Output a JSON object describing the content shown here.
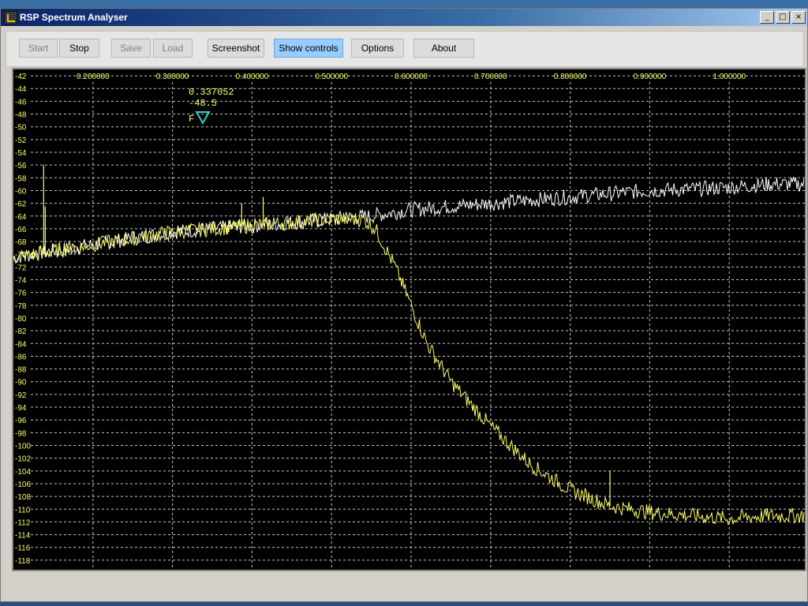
{
  "window": {
    "title": "RSP Spectrum Analyser"
  },
  "window_controls": [
    "_",
    "□",
    "×"
  ],
  "toolbar": {
    "start": "Start",
    "stop": "Stop",
    "save": "Save",
    "load": "Load",
    "screenshot": "Screenshot",
    "show_controls": "Show controls",
    "options": "Options",
    "about": "About"
  },
  "marker": {
    "frequency": "0.337052",
    "level": "-48.5",
    "label": "F"
  },
  "colors": {
    "trace_live": "#ffff66",
    "trace_reference": "#ffffff",
    "marker": "#33cccc",
    "grid": "#c8c8c8",
    "axis_text": "#ffff66"
  },
  "chart_data": {
    "type": "line",
    "x_tick_labels": [
      "0.200000",
      "0.300000",
      "0.400000",
      "0.500000",
      "0.600000",
      "0.700000",
      "0.800000",
      "0.900000",
      "1.000000"
    ],
    "x_ticks": [
      0.2,
      0.3,
      0.4,
      0.5,
      0.6,
      0.7,
      0.8,
      0.9,
      1.0
    ],
    "y_tick_labels": [
      "-42",
      "-44",
      "-46",
      "-48",
      "-50",
      "-52",
      "-54",
      "-56",
      "-58",
      "-60",
      "-62",
      "-64",
      "-66",
      "-68",
      "-70",
      "-72",
      "-74",
      "-76",
      "-78",
      "-80",
      "-82",
      "-84",
      "-86",
      "-88",
      "-90",
      "-92",
      "-94",
      "-96",
      "-98",
      "-100",
      "-102",
      "-104",
      "-106",
      "-108",
      "-110",
      "-112",
      "-114",
      "-116",
      "-118"
    ],
    "y_ticks": [
      -42,
      -44,
      -46,
      -48,
      -50,
      -52,
      -54,
      -56,
      -58,
      -60,
      -62,
      -64,
      -66,
      -68,
      -70,
      -72,
      -74,
      -76,
      -78,
      -80,
      -82,
      -84,
      -86,
      -88,
      -90,
      -92,
      -94,
      -96,
      -98,
      -100,
      -102,
      -104,
      -106,
      -108,
      -110,
      -112,
      -114,
      -116,
      -118
    ],
    "xlim": [
      0.1,
      1.095
    ],
    "ylim": [
      -119.5,
      -41
    ],
    "series": [
      {
        "color": "#ffffff",
        "x": [
          0.1,
          0.15,
          0.2,
          0.25,
          0.3,
          0.35,
          0.4,
          0.45,
          0.5,
          0.55,
          0.6,
          0.65,
          0.7,
          0.75,
          0.8,
          0.85,
          0.9,
          0.95,
          1.0,
          1.05,
          1.095
        ],
        "y": [
          -70.5,
          -69.5,
          -68.5,
          -67.5,
          -66.5,
          -66,
          -65.5,
          -65,
          -64.5,
          -64,
          -63,
          -62.5,
          -62,
          -61.5,
          -61,
          -60.5,
          -60,
          -59.8,
          -59.5,
          -59,
          -59
        ]
      },
      {
        "color": "#ffff66",
        "x": [
          0.1,
          0.15,
          0.2,
          0.25,
          0.3,
          0.35,
          0.4,
          0.45,
          0.5,
          0.54,
          0.555,
          0.58,
          0.6,
          0.62,
          0.65,
          0.7,
          0.75,
          0.8,
          0.85,
          0.9,
          0.95,
          1.0,
          1.05,
          1.095
        ],
        "y": [
          -70.5,
          -69.5,
          -68.5,
          -67.5,
          -66.5,
          -66,
          -65.5,
          -65,
          -64.5,
          -64.5,
          -66,
          -72,
          -78,
          -84,
          -90,
          -97,
          -103,
          -107,
          -109.5,
          -110.5,
          -111,
          -111.5,
          -111,
          -111
        ]
      }
    ],
    "spurs": [
      {
        "x": 0.138,
        "y": -56
      },
      {
        "x": 0.14,
        "y": -62.5
      },
      {
        "x": 0.387,
        "y": -62
      },
      {
        "x": 0.414,
        "y": -61
      },
      {
        "x": 0.85,
        "y": -104
      }
    ]
  }
}
